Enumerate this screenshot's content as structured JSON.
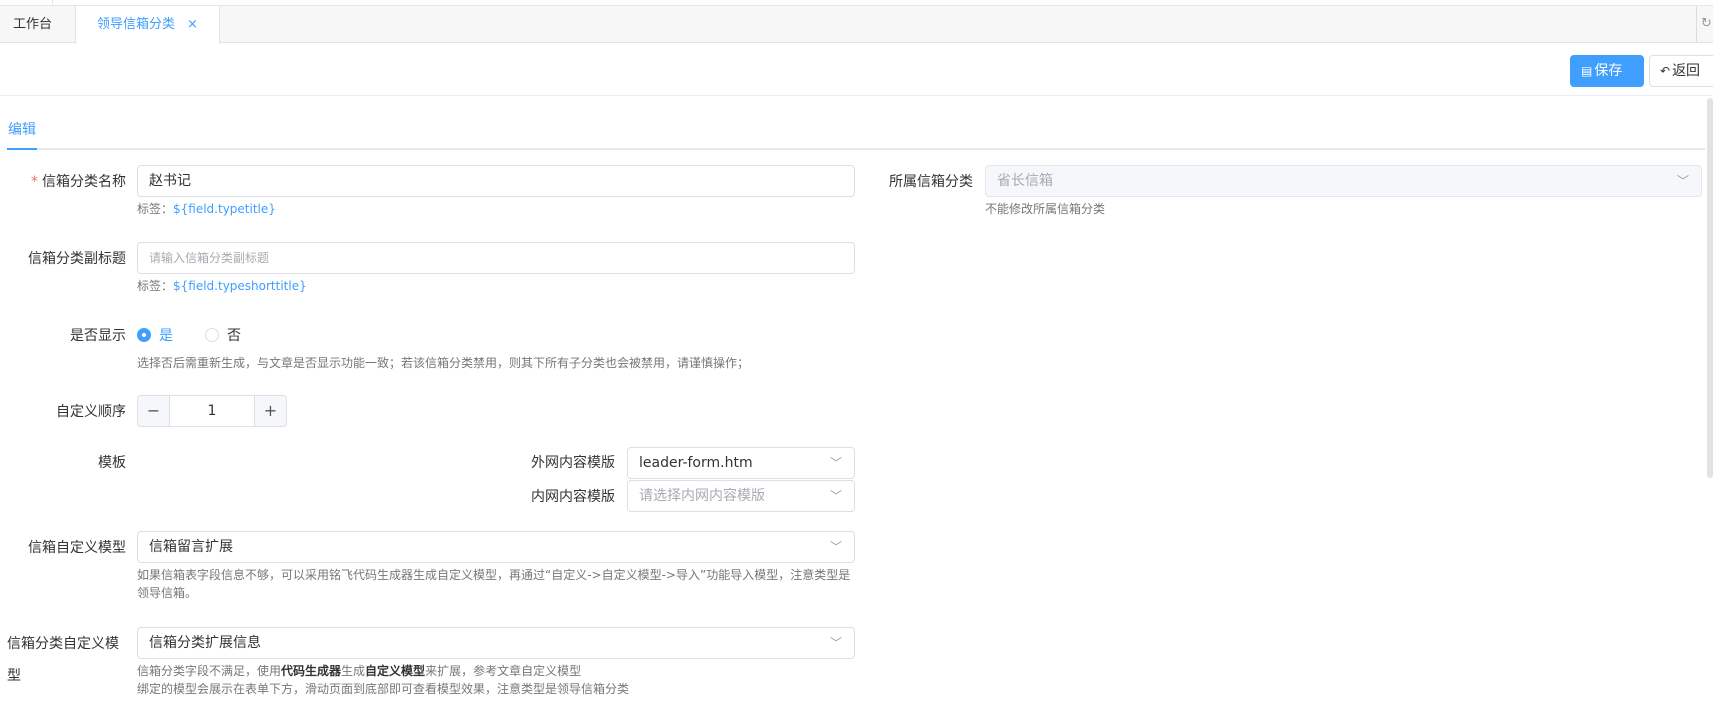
{
  "tabs": {
    "items": [
      {
        "label": "工作台"
      },
      {
        "label": "领导信箱分类",
        "close": "×"
      }
    ]
  },
  "toolbar": {
    "save_label": "保存",
    "back_label": "返回"
  },
  "subtabs": {
    "active": "编辑"
  },
  "form": {
    "name": {
      "label": "信箱分类名称",
      "required_mark": "*",
      "value": "赵书记",
      "help_prefix": "标签：",
      "help_code": "${field.typetitle}"
    },
    "parent": {
      "label": "所属信箱分类",
      "value": "省长信箱",
      "help": "不能修改所属信箱分类"
    },
    "subtitle": {
      "label": "信箱分类副标题",
      "placeholder": "请输入信箱分类副标题",
      "help_prefix": "标签：",
      "help_code": "${field.typeshorttitle}"
    },
    "display": {
      "label": "是否显示",
      "options": [
        "是",
        "否"
      ],
      "selected": "是",
      "help": "选择否后需重新生成，与文章是否显示功能一致；若该信箱分类禁用，则其下所有子分类也会被禁用，请谨慎操作；"
    },
    "order": {
      "label": "自定义顺序",
      "value": "1",
      "minus": "−",
      "plus": "+"
    },
    "template": {
      "label": "模板",
      "outer_label": "外网内容模版",
      "outer_value": "leader-form.htm",
      "inner_label": "内网内容模版",
      "inner_placeholder": "请选择内网内容模版"
    },
    "mailbox_model": {
      "label": "信箱自定义模型",
      "value": "信箱留言扩展",
      "help_line1": "如果信箱表字段信息不够，可以采用铭飞代码生成器生成自定义模型，再通过“自定义->自定义模型->导入”功能导入模型，注意类型是",
      "help_line2": "领导信箱。"
    },
    "category_model": {
      "label": "信箱分类自定义模",
      "label2": "型",
      "value": "信箱分类扩展信息",
      "help1_a": "信箱分类字段不满足，使用",
      "help1_b": "代码生成器",
      "help1_c": "生成",
      "help1_d": "自定义模型",
      "help1_e": "来扩展，参考文章自定义模型",
      "help2": "绑定的模型会展示在表单下方，滑动页面到底部即可查看模型效果，注意类型是领导信箱分类"
    }
  }
}
